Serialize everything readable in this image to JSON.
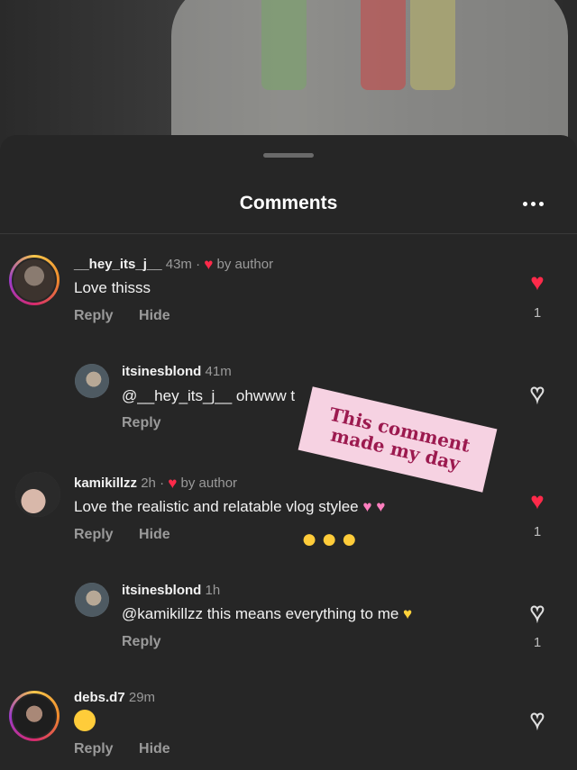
{
  "header": {
    "title": "Comments",
    "more_icon": "ellipsis-icon"
  },
  "comments": [
    {
      "username": "__hey_its_j__",
      "time": "43m",
      "badge": "by author",
      "text": "Love thisss",
      "reply": "Reply",
      "hide": "Hide",
      "likes": "1",
      "liked": true
    },
    {
      "username": "itsinesblond",
      "time": "41m",
      "text": "@__hey_its_j__ ohwww t",
      "reply": "Reply",
      "liked": false
    },
    {
      "username": "kamikillzz",
      "time": "2h",
      "badge": "by author",
      "text": "Love the realistic and relatable vlog stylee",
      "reply": "Reply",
      "hide": "Hide",
      "likes": "1",
      "liked": true
    },
    {
      "username": "itsinesblond",
      "time": "1h",
      "text": "@kamikillzz this means everything to me",
      "reply": "Reply",
      "likes": "1",
      "liked": false
    },
    {
      "username": "debs.d7",
      "time": "29m",
      "text": "",
      "reply": "Reply",
      "hide": "Hide",
      "liked": false
    }
  ],
  "sticker": {
    "line1": "This comment",
    "line2": "made my day"
  },
  "colors": {
    "like_red": "#ff2a4a",
    "sticker_bg": "#f6d2e2",
    "sticker_text": "#9c1a4f"
  }
}
